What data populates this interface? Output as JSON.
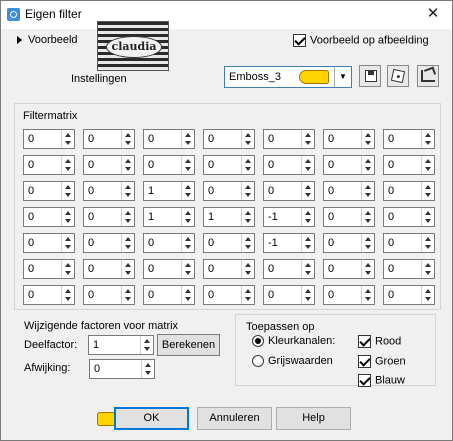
{
  "window": {
    "title": "Eigen filter",
    "close_glyph": "✕"
  },
  "preview": {
    "toggle_label": "Voorbeeld",
    "on_image_label": "Voorbeeld op afbeelding",
    "on_image_checked": true
  },
  "logo_text": "claudia",
  "settings": {
    "label": "Instellingen",
    "preset_value": "Emboss_3"
  },
  "filter_matrix": {
    "title": "Filtermatrix",
    "rows": [
      [
        "0",
        "0",
        "0",
        "0",
        "0",
        "0",
        "0"
      ],
      [
        "0",
        "0",
        "0",
        "0",
        "0",
        "0",
        "0"
      ],
      [
        "0",
        "0",
        "1",
        "0",
        "0",
        "0",
        "0"
      ],
      [
        "0",
        "0",
        "1",
        "1",
        "-1",
        "0",
        "0"
      ],
      [
        "0",
        "0",
        "0",
        "0",
        "-1",
        "0",
        "0"
      ],
      [
        "0",
        "0",
        "0",
        "0",
        "0",
        "0",
        "0"
      ],
      [
        "0",
        "0",
        "0",
        "0",
        "0",
        "0",
        "0"
      ]
    ]
  },
  "factors": {
    "title": "Wijzigende factoren voor matrix",
    "divisor_label": "Deelfactor:",
    "divisor_value": "1",
    "compute_label": "Berekenen",
    "offset_label": "Afwijking:",
    "offset_value": "0"
  },
  "apply": {
    "title": "Toepassen op",
    "color_channels_label": "Kleurkanalen:",
    "grayscale_label": "Grijswaarden",
    "mode": "color",
    "red_label": "Rood",
    "green_label": "Groen",
    "blue_label": "Blauw",
    "red_checked": true,
    "green_checked": true,
    "blue_checked": true
  },
  "buttons": {
    "ok": "OK",
    "cancel": "Annuleren",
    "help": "Help"
  },
  "icons": {
    "app": "app-icon",
    "save": "floppy-icon",
    "random": "dice-icon",
    "reset": "reset-icon",
    "pointer": "pointing-hand-icon"
  },
  "colors": {
    "accent": "#0078d7",
    "hand": "#ffd400",
    "dialog_bg": "#f0f0f0"
  }
}
